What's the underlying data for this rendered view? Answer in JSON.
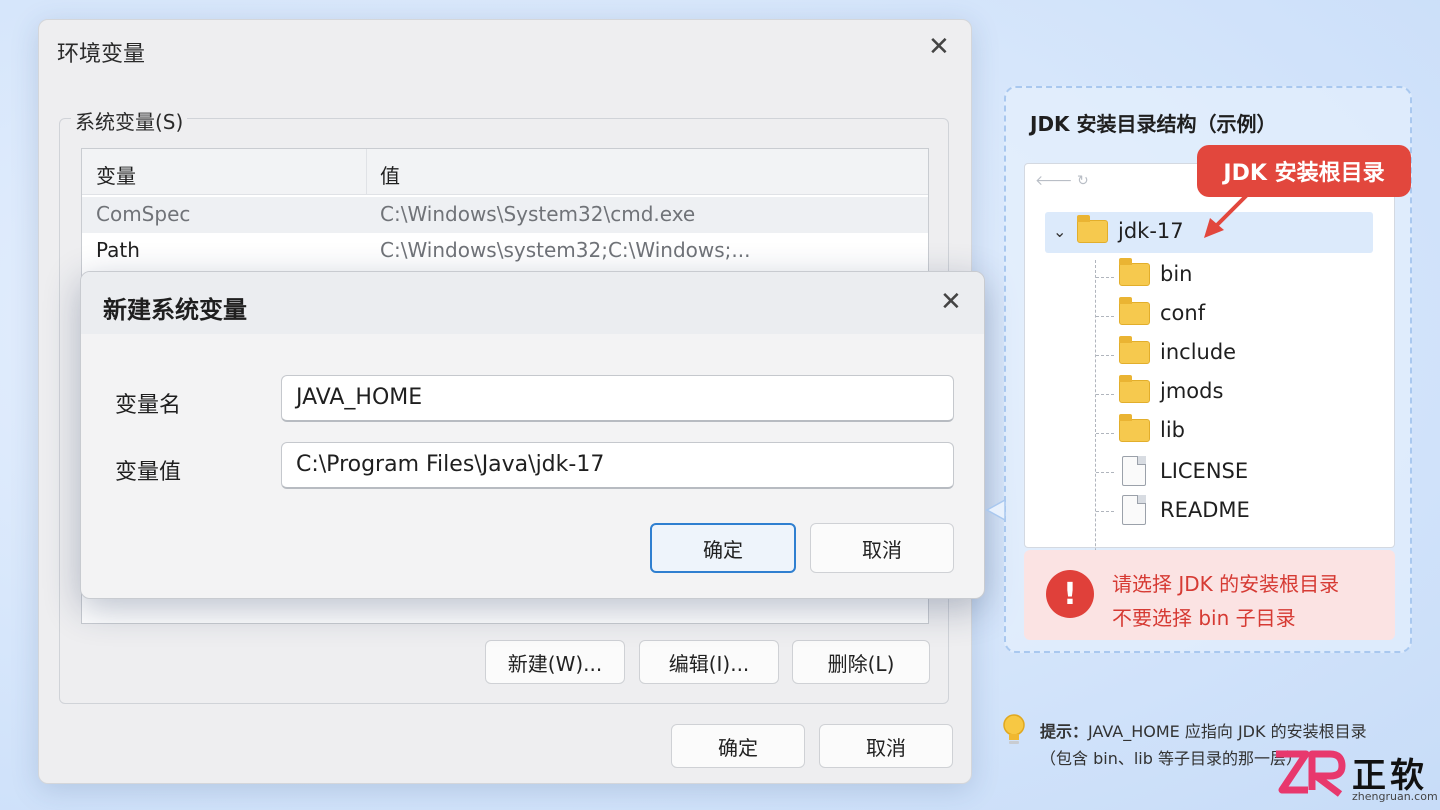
{
  "env_window": {
    "title": "环境变量",
    "group_label": "系统变量(S)",
    "table": {
      "headers": [
        "变量",
        "值"
      ],
      "rows": [
        {
          "name": "ComSpec",
          "value": "C:\\Windows\\System32\\cmd.exe"
        },
        {
          "name": "Path",
          "value": "C:\\Windows\\system32;C:\\Windows;..."
        }
      ]
    },
    "buttons": {
      "new": "新建(W)...",
      "edit": "编辑(I)...",
      "delete": "删除(L)"
    },
    "footer": {
      "ok": "确定",
      "cancel": "取消"
    }
  },
  "dialog": {
    "title": "新建系统变量",
    "name_label": "变量名",
    "name_value": "JAVA_HOME",
    "value_label": "变量值",
    "value_value": "C:\\Program Files\\Java\\jdk-17",
    "ok": "确定",
    "cancel": "取消"
  },
  "jdk_panel": {
    "title": "JDK 安装目录结构（示例）",
    "callout": "JDK 安装根目录",
    "tree": {
      "root": "jdk-17",
      "children": [
        {
          "name": "bin",
          "type": "folder"
        },
        {
          "name": "conf",
          "type": "folder"
        },
        {
          "name": "include",
          "type": "folder"
        },
        {
          "name": "jmods",
          "type": "folder"
        },
        {
          "name": "lib",
          "type": "folder"
        },
        {
          "name": "LICENSE",
          "type": "file"
        },
        {
          "name": "README",
          "type": "file"
        }
      ]
    },
    "warning": {
      "line1": "请选择 JDK 的安装根目录",
      "line2": "不要选择 bin 子目录"
    }
  },
  "tip": {
    "label": "提示：",
    "line1": "JAVA_HOME 应指向 JDK 的安装根目录",
    "line2": "（包含 bin、lib 等子目录的那一层）"
  },
  "watermark": {
    "brand": "正软",
    "domain": "zhengruan.com"
  },
  "colors": {
    "accent": "#2f7fd0",
    "warning": "#e2473d",
    "folder": "#f6c94e",
    "selection": "#dceafb"
  }
}
